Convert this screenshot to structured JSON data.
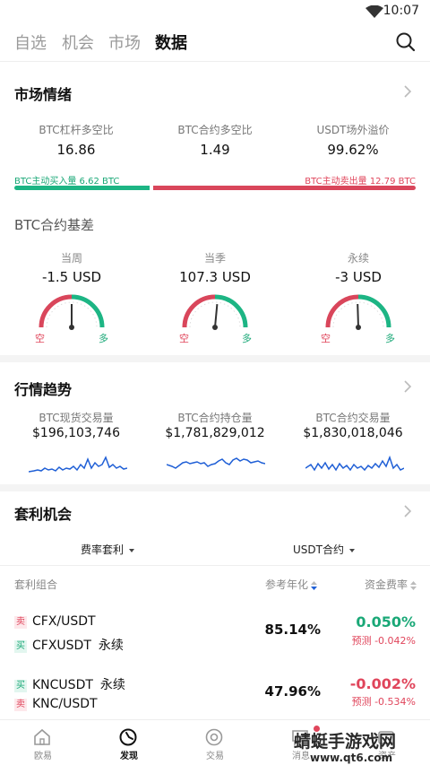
{
  "status_bar": {
    "time": "10:07"
  },
  "top_tabs": [
    "自选",
    "机会",
    "市场",
    "数据"
  ],
  "sentiment": {
    "title": "市场情绪",
    "stats": [
      {
        "label": "BTC杠杆多空比",
        "value": "16.86"
      },
      {
        "label": "BTC合约多空比",
        "value": "1.49"
      },
      {
        "label": "USDT场外溢价",
        "value": "99.62%"
      }
    ],
    "buy_label": "BTC主动买入量 6.62 BTC",
    "sell_label": "BTC主动卖出量 12.79 BTC",
    "buy_amount": 6.62,
    "sell_amount": 12.79
  },
  "basis": {
    "title": "BTC合约基差",
    "short_label": "空",
    "long_label": "多",
    "gauges": [
      {
        "label": "当周",
        "value": "-1.5 USD",
        "needle_fraction": 0.5
      },
      {
        "label": "当季",
        "value": "107.3 USD",
        "needle_fraction": 0.53
      },
      {
        "label": "永续",
        "value": "-3 USD",
        "needle_fraction": 0.49
      }
    ]
  },
  "trend": {
    "title": "行情趋势",
    "items": [
      {
        "label": "BTC现货交易量",
        "value": "$196,103,746"
      },
      {
        "label": "BTC合约持仓量",
        "value": "$1,781,829,012"
      },
      {
        "label": "BTC合约交易量",
        "value": "$1,830,018,046"
      }
    ]
  },
  "arbitrage": {
    "title": "套利机会",
    "filters": [
      "费率套利",
      "USDT合约"
    ],
    "columns": [
      "套利组合",
      "参考年化",
      "资金费率"
    ],
    "rows": [
      {
        "leg1_tag": "卖",
        "leg1_name": "CFX/USDT",
        "leg1_suffix": "",
        "leg2_tag": "买",
        "leg2_name": "CFXUSDT",
        "leg2_suffix": "永续",
        "annual": "85.14%",
        "rate": "0.050%",
        "pred": "预测 -0.042%"
      },
      {
        "leg1_tag": "买",
        "leg1_name": "KNCUSDT",
        "leg1_suffix": "永续",
        "leg2_tag": "卖",
        "leg2_name": "KNC/USDT",
        "leg2_suffix": "",
        "annual": "47.96%",
        "rate": "-0.002%",
        "pred": "预测 -0.534%"
      }
    ]
  },
  "bottom_nav": [
    "欧易",
    "发现",
    "交易",
    "消息",
    "资产"
  ],
  "watermark": {
    "main": "蜻蜓手游戏网",
    "sub": "www.qt6.com"
  },
  "colors": {
    "green": "#1db584",
    "red": "#d9465b",
    "blue": "#1f5fd6"
  }
}
